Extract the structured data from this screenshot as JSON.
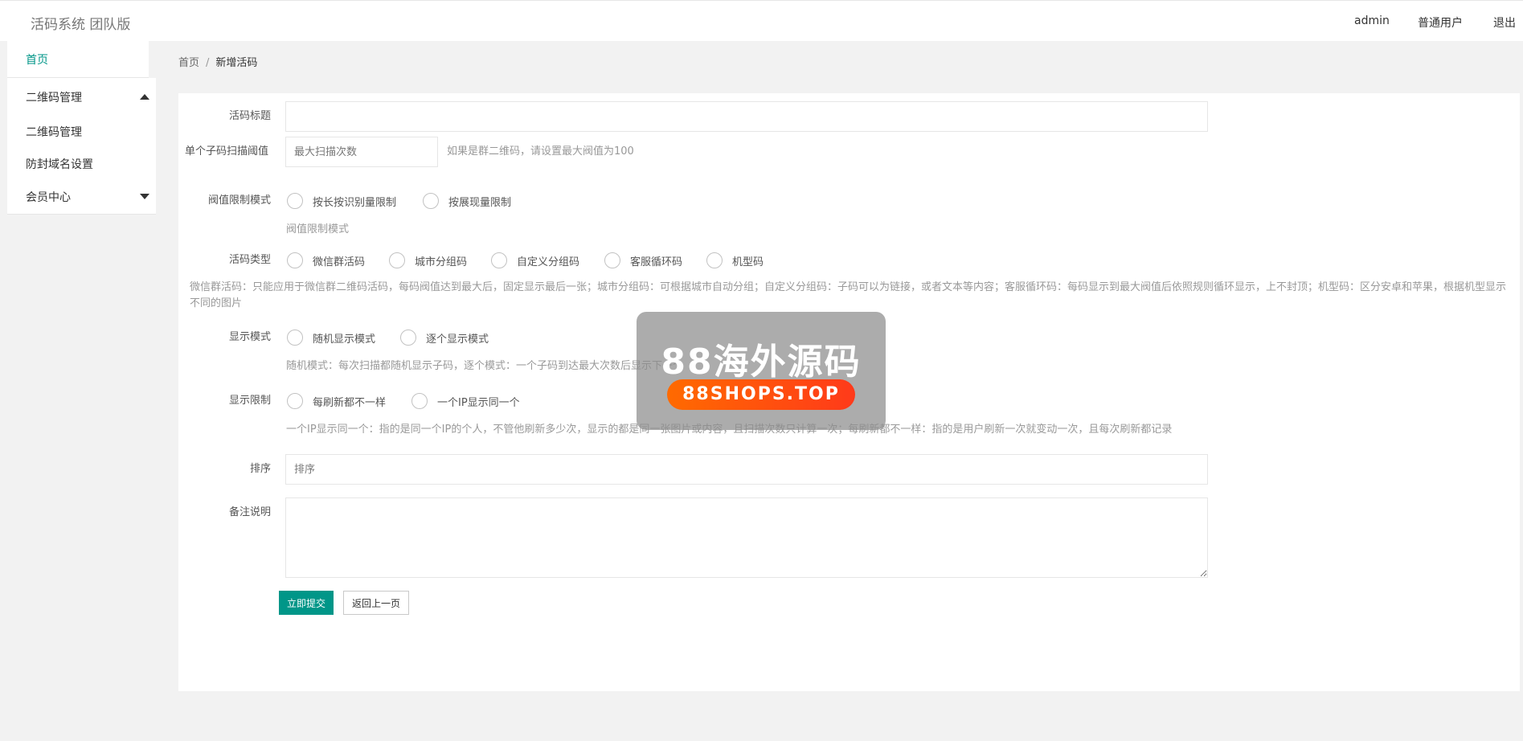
{
  "header": {
    "logo": "活码系统 团队版",
    "user": "admin",
    "role": "普通用户",
    "logout": "退出"
  },
  "sidebar": {
    "home": "首页",
    "items": [
      {
        "label": "二维码管理",
        "expanded": true
      },
      {
        "label": "二维码管理"
      },
      {
        "label": "防封域名设置"
      },
      {
        "label": "会员中心",
        "expanded": false
      }
    ]
  },
  "breadcrumb": {
    "home": "首页",
    "sep": "/",
    "current": "新增活码"
  },
  "form": {
    "title_label": "活码标题",
    "title_value": "",
    "threshold_label": "单个子码扫描阈值",
    "threshold_placeholder": "最大扫描次数",
    "threshold_hint": "如果是群二维码，请设置最大阀值为100",
    "limit_mode_label": "阀值限制模式",
    "limit_mode_options": [
      "按长按识别量限制",
      "按展现量限制"
    ],
    "limit_mode_hint": "阀值限制模式",
    "type_label": "活码类型",
    "type_options": [
      "微信群活码",
      "城市分组码",
      "自定义分组码",
      "客服循环码",
      "机型码"
    ],
    "type_hint": "微信群活码：只能应用于微信群二维码活码，每码阀值达到最大后，固定显示最后一张；城市分组码：可根据城市自动分组；自定义分组码：子码可以为链接，或者文本等内容；客服循环码：每码显示到最大阀值后依照规则循环显示，上不封顶；机型码：区分安卓和苹果，根据机型显示不同的图片",
    "display_label": "显示模式",
    "display_options": [
      "随机显示模式",
      "逐个显示模式"
    ],
    "display_hint": "随机模式：每次扫描都随机显示子码，逐个模式：一个子码到达最大次数后显示下一个",
    "show_limit_label": "显示限制",
    "show_limit_options": [
      "每刷新都不一样",
      "一个IP显示同一个"
    ],
    "show_limit_hint": "一个IP显示同一个：指的是同一个IP的个人，不管他刷新多少次，显示的都是同一张图片或内容，且扫描次数只计算一次；每刷新都不一样：指的是用户刷新一次就变动一次，且每次刷新都记录",
    "sort_label": "排序",
    "sort_placeholder": "排序",
    "remark_label": "备注说明",
    "remark_value": "",
    "submit": "立即提交",
    "back": "返回上一页"
  },
  "watermark": {
    "title": "88海外源码",
    "badge": "88SHOPS.TOP"
  }
}
